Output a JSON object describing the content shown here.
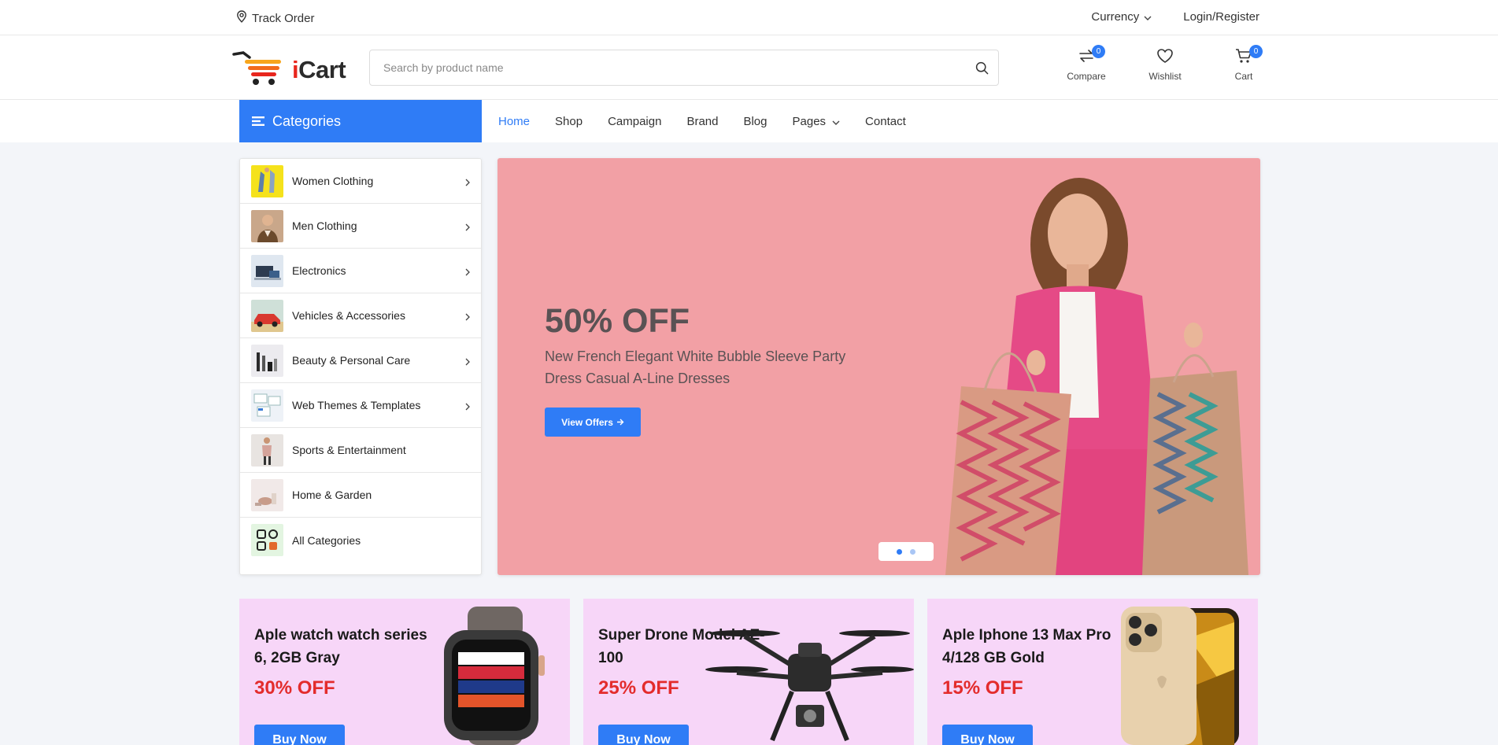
{
  "topbar": {
    "track_order": "Track Order",
    "currency": "Currency",
    "login": "Login/Register"
  },
  "header": {
    "logo_text": "iCart",
    "search_placeholder": "Search by product name",
    "compare": {
      "label": "Compare",
      "count": "0"
    },
    "wishlist": {
      "label": "Wishlist"
    },
    "cart": {
      "label": "Cart",
      "count": "0"
    }
  },
  "nav": {
    "categories_label": "Categories",
    "items": [
      "Home",
      "Shop",
      "Campaign",
      "Brand",
      "Blog",
      "Pages",
      "Contact"
    ],
    "active": "Home"
  },
  "categories": [
    {
      "label": "Women Clothing"
    },
    {
      "label": "Men Clothing"
    },
    {
      "label": "Electronics"
    },
    {
      "label": "Vehicles & Accessories"
    },
    {
      "label": "Beauty & Personal Care"
    },
    {
      "label": "Web Themes & Templates"
    },
    {
      "label": "Sports & Entertainment"
    },
    {
      "label": "Home & Garden"
    },
    {
      "label": "All Categories"
    }
  ],
  "hero": {
    "title": "50% OFF",
    "description": "New French Elegant White Bubble Sleeve Party Dress Casual A-Line Dresses",
    "button": "View Offers",
    "slides": 2,
    "active_slide": 1
  },
  "promos": [
    {
      "title": "Aple watch watch series 6, 2GB Gray",
      "discount": "30% OFF",
      "button": "Buy Now"
    },
    {
      "title": "Super Drone Model AE-100",
      "discount": "25% OFF",
      "button": "Buy Now"
    },
    {
      "title": "Aple Iphone 13 Max Pro 4/128 GB Gold",
      "discount": "15% OFF",
      "button": "Buy Now"
    }
  ],
  "colors": {
    "accent": "#2f7cf6",
    "hero_bg": "#f2a0a5",
    "promo_bg": "#f7d6f8",
    "discount": "#e32c2c"
  }
}
